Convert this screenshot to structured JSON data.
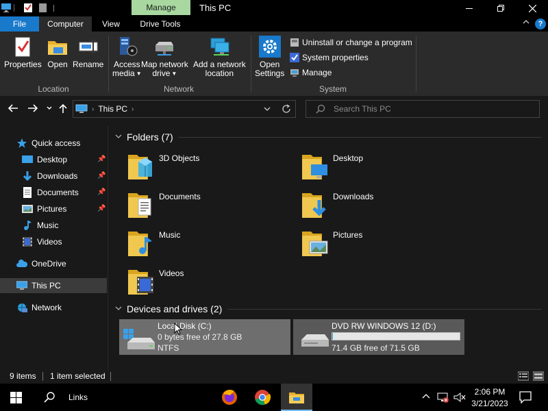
{
  "titlebar": {
    "contextual_tab": "Manage",
    "window_title": "This PC"
  },
  "tabs": {
    "file": "File",
    "computer": "Computer",
    "view": "View",
    "drive_tools": "Drive Tools",
    "help": "?"
  },
  "ribbon": {
    "location": {
      "label": "Location",
      "properties": "Properties",
      "open": "Open",
      "rename": "Rename"
    },
    "network": {
      "label": "Network",
      "access_media_1": "Access",
      "access_media_2": "media",
      "map_drive_1": "Map network",
      "map_drive_2": "drive",
      "add_location_1": "Add a network",
      "add_location_2": "location"
    },
    "system": {
      "label": "System",
      "open_settings_1": "Open",
      "open_settings_2": "Settings",
      "uninstall": "Uninstall or change a program",
      "system_properties": "System properties",
      "manage": "Manage"
    }
  },
  "address": {
    "path": "This PC",
    "search_placeholder": "Search This PC"
  },
  "sidebar": {
    "quick_access": "Quick access",
    "desktop": "Desktop",
    "downloads": "Downloads",
    "documents": "Documents",
    "pictures": "Pictures",
    "music": "Music",
    "videos": "Videos",
    "onedrive": "OneDrive",
    "this_pc": "This PC",
    "network": "Network"
  },
  "content": {
    "folders_title": "Folders (7)",
    "folders": [
      "3D Objects",
      "Desktop",
      "Documents",
      "Downloads",
      "Music",
      "Pictures",
      "Videos"
    ],
    "drives_title": "Devices and drives (2)",
    "drives": [
      {
        "name": "Local Disk (C:)",
        "free": "0 bytes free of 27.8 GB",
        "fs": "NTFS",
        "used_fraction": 1.0
      },
      {
        "name": "DVD RW WINDOWS 12 (D:)",
        "free": "71.4 GB free of 71.5 GB",
        "used_fraction": 0.0014
      }
    ]
  },
  "status": {
    "items": "9 items",
    "selected": "1 item selected"
  },
  "taskbar": {
    "search_label": "Links",
    "time": "2:06 PM",
    "date": "3/21/2023"
  },
  "colors": {
    "accent": "#1979ca",
    "manage_tab": "#a8d8a0",
    "folder": "#f0c850",
    "drive_selected": "#6e6e6e"
  }
}
